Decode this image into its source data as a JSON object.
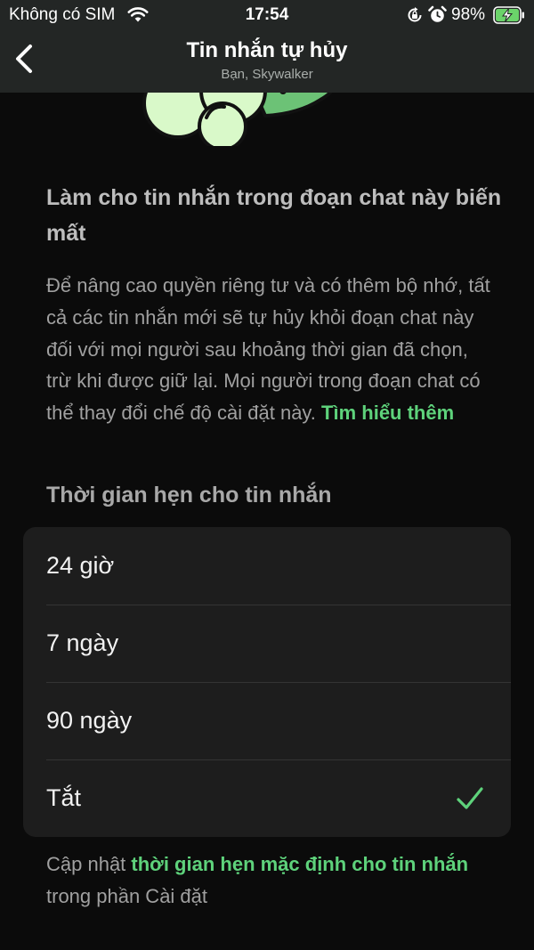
{
  "status_bar": {
    "carrier": "Không có SIM",
    "time": "17:54",
    "battery": "98%",
    "icons": [
      "wifi-icon",
      "orientation-lock-icon",
      "alarm-icon",
      "battery-charging-icon"
    ]
  },
  "nav": {
    "back_icon": "chevron-left-icon",
    "title": "Tin nhắn tự hủy",
    "subtitle": "Bạn, Skywalker"
  },
  "content": {
    "heading": "Làm cho tin nhắn trong đoạn chat này biến mất",
    "description": "Để nâng cao quyền riêng tư và có thêm bộ nhớ, tất cả các tin nhắn mới sẽ tự hủy khỏi đoạn chat này đối với mọi người sau khoảng thời gian đã chọn, trừ khi được giữ lại. Mọi người trong đoạn chat có thể thay đổi chế độ cài đặt này.",
    "learn_more": "Tìm hiểu thêm",
    "section_title": "Thời gian hẹn cho tin nhắn"
  },
  "options": [
    {
      "label": "24 giờ",
      "selected": false
    },
    {
      "label": "7 ngày",
      "selected": false
    },
    {
      "label": "90 ngày",
      "selected": false
    },
    {
      "label": "Tắt",
      "selected": true
    }
  ],
  "footer": {
    "prefix": "Cập nhật",
    "link": "thời gian hẹn mặc định cho tin nhắn",
    "suffix": "trong phần Cài đặt"
  },
  "colors": {
    "accent": "#5ed27b",
    "header_bg": "#232625",
    "background": "#0b0b0b",
    "card_bg": "#1d1d1d",
    "illustration": "#d9f9c9"
  }
}
